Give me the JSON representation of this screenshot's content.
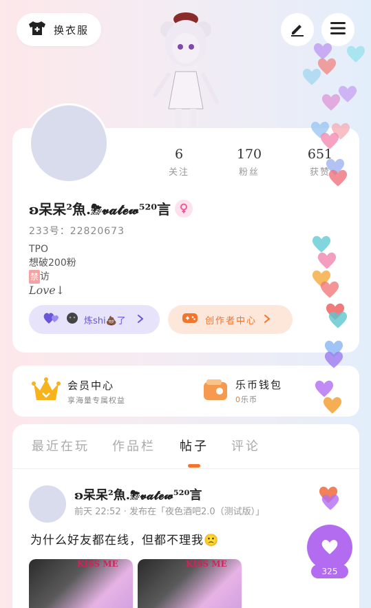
{
  "header": {
    "wardrobe_label": "换衣服"
  },
  "profile": {
    "stats": [
      {
        "value": "6",
        "label": "关注"
      },
      {
        "value": "170",
        "label": "粉丝"
      },
      {
        "value": "651",
        "label": "获赞"
      }
    ],
    "name": "ʚ呆呆²魚.⛈𝓿𝓪𝓽𝓮𝔀⁵²⁰言",
    "id_line": "233号：22820673",
    "bio_lines": [
      "TPO",
      "想破200粉"
    ],
    "ban_badge": "禁",
    "ban_rest": "访",
    "love_line": "Love↓",
    "pill_left_text": "炼shi💩了",
    "pill_right_text": "创作者中心"
  },
  "member": {
    "vip_title": "会员中心",
    "vip_sub": "享海量专属权益",
    "wallet_title": "乐币钱包",
    "wallet_amount": "0",
    "wallet_unit": "乐币"
  },
  "tabs": [
    "最近在玩",
    "作品栏",
    "帖子",
    "评论"
  ],
  "active_tab": "帖子",
  "post": {
    "name": "ʚ呆呆²魚.⛈𝓿𝓪𝓽𝓮𝔀⁵²⁰言",
    "meta": "前天 22:52 · 发布在「夜色酒吧2.0（测试版）」",
    "text": "为什么好友都在线，但都不理我🙁",
    "image_caption": "KISS ME"
  },
  "like_count": "325",
  "colors": {
    "accent_orange": "#f3742d",
    "accent_purple": "#b36bf0",
    "pill_purple": "#6b55d9"
  }
}
